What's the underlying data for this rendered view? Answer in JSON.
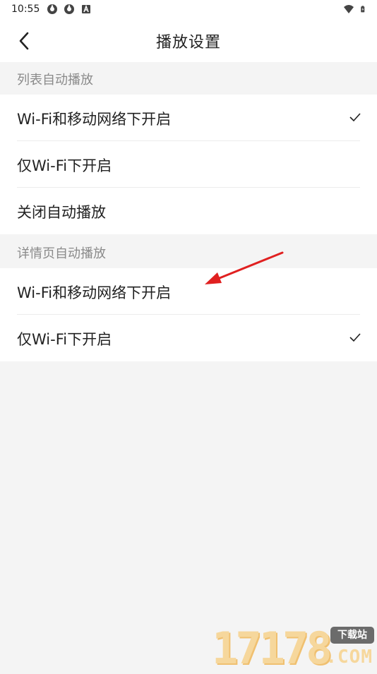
{
  "status_bar": {
    "time": "10:55",
    "left_icons": [
      "app-notification-icon",
      "app-notification-icon",
      "a-badge-icon"
    ],
    "right_icons": [
      "wifi-icon",
      "battery-icon"
    ]
  },
  "header": {
    "title": "播放设置",
    "back_icon": "chevron-left-icon"
  },
  "sections": [
    {
      "title": "列表自动播放",
      "options": [
        {
          "label": "Wi-Fi和移动网络下开启",
          "selected": true
        },
        {
          "label": "仅Wi-Fi下开启",
          "selected": false
        },
        {
          "label": "关闭自动播放",
          "selected": false
        }
      ]
    },
    {
      "title": "详情页自动播放",
      "options": [
        {
          "label": "Wi-Fi和移动网络下开启",
          "selected": false
        },
        {
          "label": "仅Wi-Fi下开启",
          "selected": true
        }
      ]
    }
  ],
  "colors": {
    "background": "#f4f4f4",
    "surface": "#ffffff",
    "text": "#222222",
    "section_text": "#8a8a8a",
    "annotation": "#e02020"
  },
  "watermark": {
    "digits": "17178",
    "badge": "下载站",
    "domain": ".COM"
  }
}
